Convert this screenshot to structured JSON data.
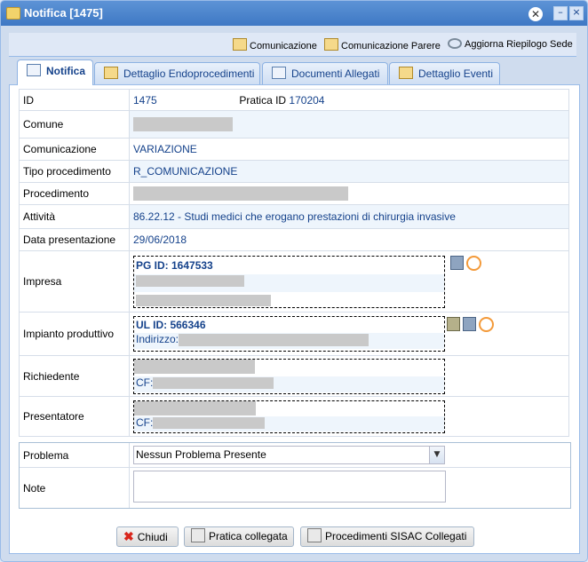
{
  "window": {
    "title": "Notifica [1475]"
  },
  "toolbar": {
    "comunicazione": "Comunicazione",
    "comunicazione_parere": "Comunicazione Parere",
    "aggiorna": "Aggiorna Riepilogo Sede"
  },
  "tabs": [
    {
      "label": "Notifica"
    },
    {
      "label": "Dettaglio Endoprocedimenti"
    },
    {
      "label": "Documenti Allegati"
    },
    {
      "label": "Dettaglio Eventi"
    }
  ],
  "fields": {
    "id_label": "ID",
    "id_value": "1475",
    "pratica_label": "Pratica ID",
    "pratica_value": "170204",
    "comune_label": "Comune",
    "comunicazione_label": "Comunicazione",
    "comunicazione_value": "VARIAZIONE",
    "tipo_label": "Tipo procedimento",
    "tipo_value": "R_COMUNICAZIONE",
    "procedimento_label": "Procedimento",
    "attivita_label": "Attività",
    "attivita_value": "86.22.12 - Studi medici che erogano prestazioni di chirurgia invasive",
    "data_label": "Data presentazione",
    "data_value": "29/06/2018",
    "impresa_label": "Impresa",
    "impresa_pg": "PG ID: 1647533",
    "impianto_label": "Impianto produttivo",
    "impianto_ul": "UL ID: 566346",
    "indirizzo_label": "Indirizzo:",
    "richiedente_label": "Richiedente",
    "cf_label": "CF:",
    "presentatore_label": "Presentatore"
  },
  "problema": {
    "label": "Problema",
    "selected": "Nessun Problema Presente",
    "note_label": "Note"
  },
  "buttons": {
    "chiudi": "Chiudi",
    "pratica_collegata": "Pratica collegata",
    "procedimenti": "Procedimenti SISAC Collegati"
  }
}
